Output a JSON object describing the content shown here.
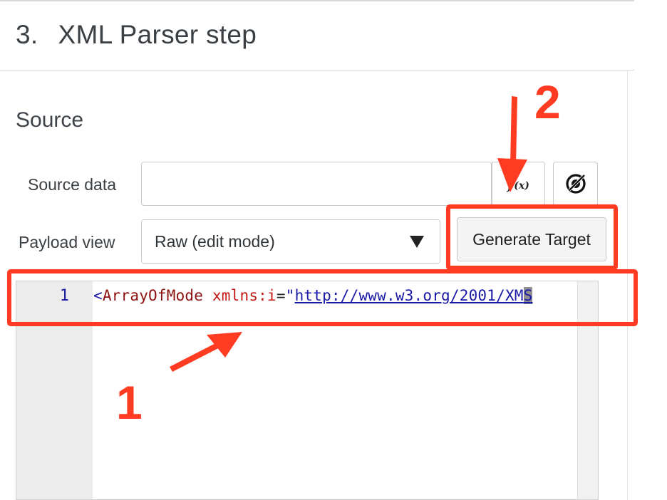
{
  "header": {
    "step_number": "3.",
    "title": "XML Parser step"
  },
  "section": {
    "title": "Source"
  },
  "source_data": {
    "label": "Source data",
    "value": "",
    "fx_main": "f",
    "fx_sub": "(x)"
  },
  "payload_view": {
    "label": "Payload view",
    "selected": "Raw (edit mode)"
  },
  "generate_target": {
    "label": "Generate Target"
  },
  "editor": {
    "line_number": "1",
    "code": {
      "open": "<",
      "tag": "ArrayOfMode",
      "attr": "xmlns:i",
      "eq": "=",
      "quote": "\"",
      "url": "http://www.w3.org/2001/XM",
      "cursor_char": "S"
    }
  },
  "annotations": {
    "one": "1",
    "two": "2",
    "color": "#ff3b22"
  }
}
